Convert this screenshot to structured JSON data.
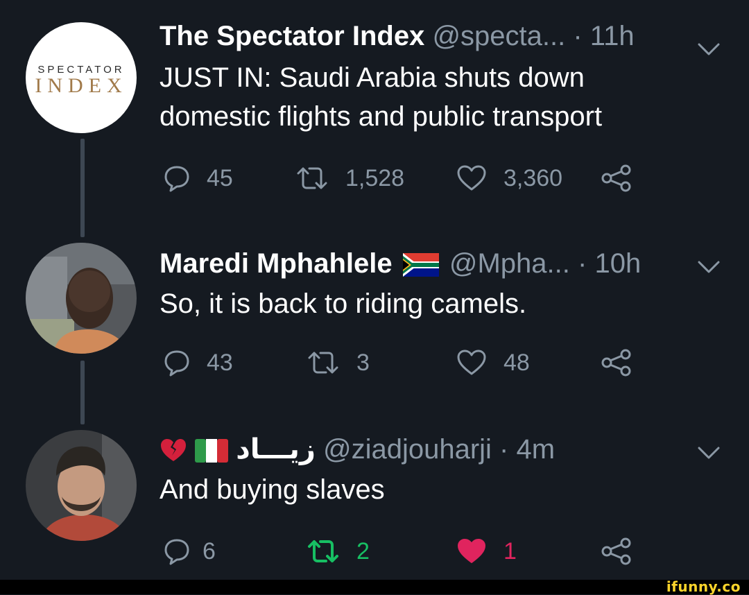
{
  "tweets": [
    {
      "display_name": "The Spectator Index",
      "handle": "@specta...",
      "time": "· 11h",
      "text_lines": [
        "JUST IN: Saudi Arabia shuts down",
        "domestic flights and public transport"
      ],
      "avatar": {
        "logo_top": "SPECTATOR",
        "logo_bottom": "INDEX"
      },
      "replies": "45",
      "retweets": "1,528",
      "likes": "3,360"
    },
    {
      "display_name": "Maredi Mphahlele",
      "flag": "south-africa-flag-icon",
      "handle": "@Mpha...",
      "time": "· 10h",
      "text_lines": [
        "So, it is back to riding camels."
      ],
      "replies": "43",
      "retweets": "3",
      "likes": "48"
    },
    {
      "display_name": "زيـــاد",
      "emojis": [
        "broken-heart-icon",
        "italy-flag-icon"
      ],
      "handle": "@ziadjouharji · 4m",
      "text_lines": [
        "And buying slaves"
      ],
      "replies": "6",
      "retweets": "2",
      "likes": "1",
      "retweeted": true,
      "liked": true
    }
  ],
  "colors": {
    "background": "#151a21",
    "muted": "#8b98a5",
    "retweet_active": "#17bf63",
    "like_active": "#e0245e",
    "watermark": "#fbd42b"
  },
  "watermark": "ifunny.co"
}
